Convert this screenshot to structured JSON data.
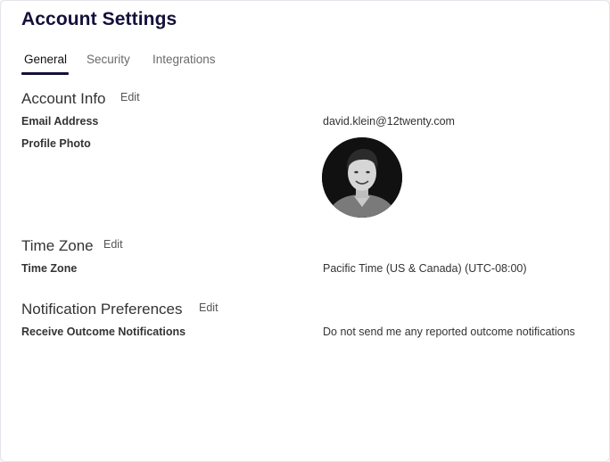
{
  "page": {
    "title": "Account Settings"
  },
  "tabs": [
    {
      "label": "General",
      "active": true
    },
    {
      "label": "Security",
      "active": false
    },
    {
      "label": "Integrations",
      "active": false
    }
  ],
  "sections": {
    "account_info": {
      "title": "Account Info",
      "edit_label": "Edit",
      "fields": {
        "email": {
          "label": "Email Address",
          "value": "david.klein@12twenty.com"
        },
        "photo": {
          "label": "Profile Photo"
        }
      }
    },
    "time_zone": {
      "title": "Time Zone",
      "edit_label": "Edit",
      "fields": {
        "tz": {
          "label": "Time Zone",
          "value": "Pacific Time (US & Canada) (UTC-08:00)"
        }
      }
    },
    "notifications": {
      "title": "Notification Preferences",
      "edit_label": "Edit",
      "fields": {
        "outcome": {
          "label": "Receive Outcome Notifications",
          "value": "Do not send me any reported outcome notifications"
        }
      }
    }
  },
  "colors": {
    "title": "#14103a",
    "tab_active_underline": "#14103a",
    "tab_inactive_text": "#6b6b6b"
  },
  "icons": {
    "avatar": "profile-photo"
  }
}
